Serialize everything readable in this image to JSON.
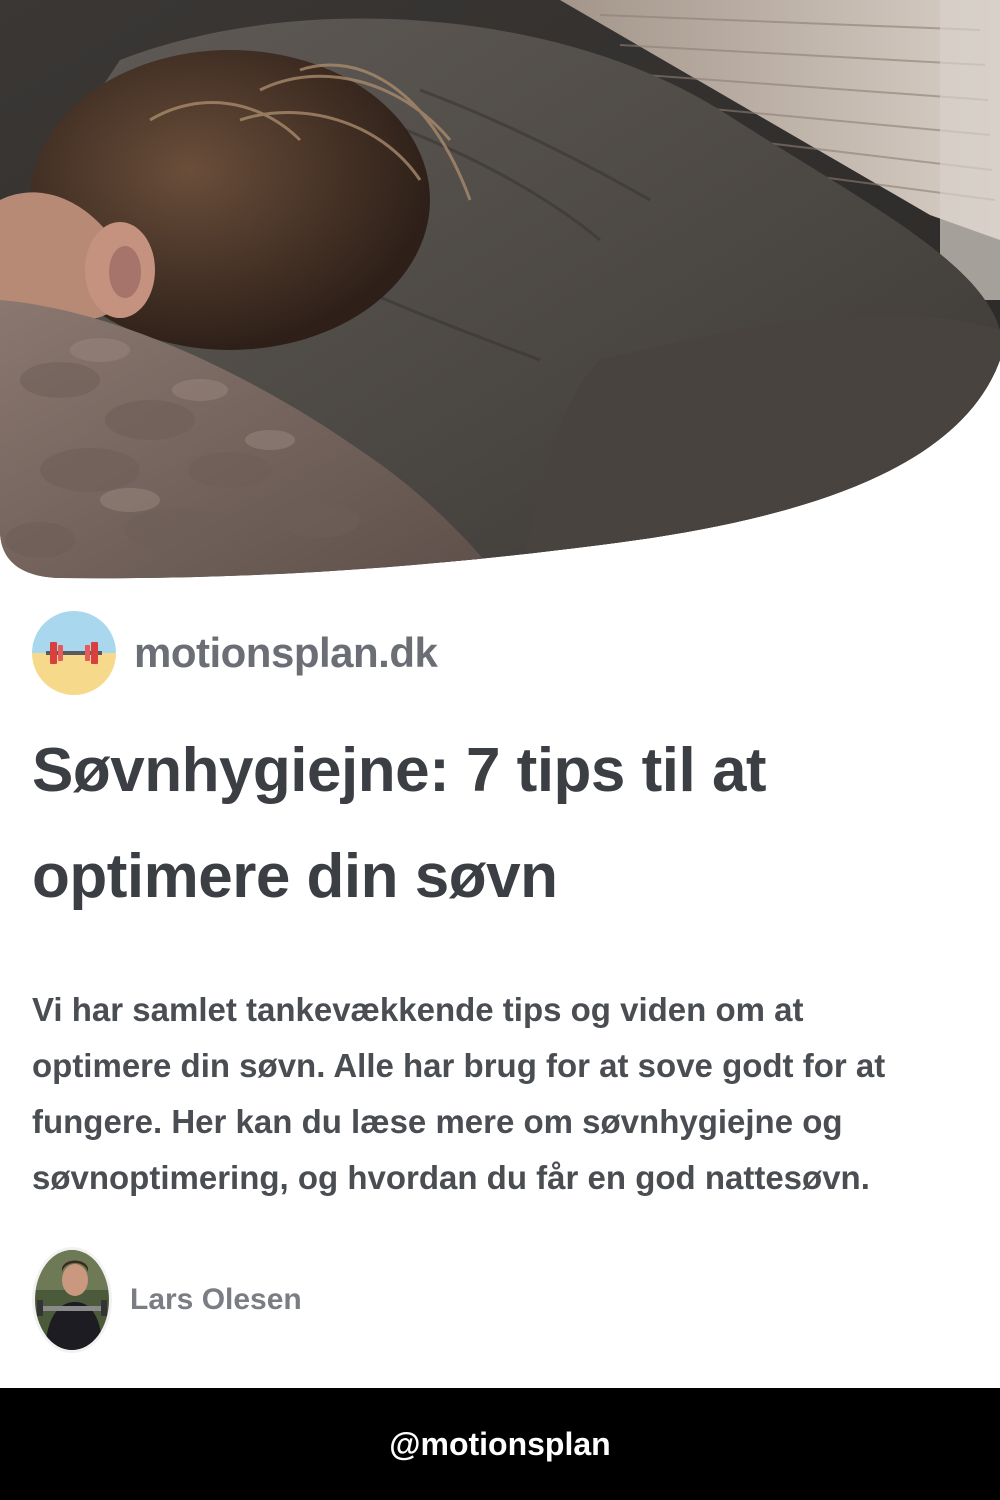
{
  "hero": {
    "image_alt": "person sleeping on pillow"
  },
  "site": {
    "name": "motionsplan.dk",
    "logo_icon": "dumbbell-icon"
  },
  "article": {
    "title": "Søvnhygiejne: 7 tips til at optimere din søvn",
    "description": "Vi har samlet tankevækkende tips og viden om at optimere din søvn. Alle har brug for at sove godt for at fungere. Her kan du læse mere om søvnhygiejne og søvnoptimering, og hvordan du får en god nattesøvn."
  },
  "author": {
    "name": "Lars Olesen"
  },
  "footer": {
    "handle": "@motionsplan"
  },
  "colors": {
    "footer_bg": "#000000",
    "title": "#3b3f44",
    "site_name": "#6b6f75"
  }
}
